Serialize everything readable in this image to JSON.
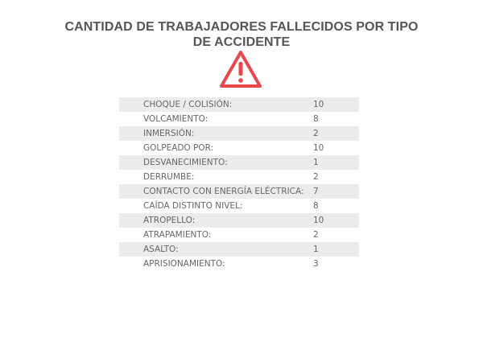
{
  "chart_data": {
    "type": "table",
    "title_lines": [
      "CANTIDAD DE TRABAJADORES FALLECIDOS POR TIPO",
      "DE ACCIDENTE"
    ],
    "icon": "warning-triangle-icon",
    "colors": {
      "icon": "#e8474b",
      "row_shade": "#ececec",
      "text": "#666666",
      "title": "#555555"
    },
    "rows": [
      {
        "label": "CHOQUE / COLISIÓN:",
        "value": "10"
      },
      {
        "label": "VOLCAMIENTO:",
        "value": "8"
      },
      {
        "label": "INMERSIÓN:",
        "value": "2"
      },
      {
        "label": "GOLPEADO POR:",
        "value": "10"
      },
      {
        "label": "DESVANECIMIENTO:",
        "value": "1"
      },
      {
        "label": "DERRUMBE:",
        "value": "2"
      },
      {
        "label": "CONTACTO CON ENERGÍA ELÉCTRICA:",
        "value": "7"
      },
      {
        "label": "CAÍDA DISTINTO NIVEL:",
        "value": "8"
      },
      {
        "label": "ATROPELLO:",
        "value": "10"
      },
      {
        "label": "ATRAPAMIENTO:",
        "value": "2"
      },
      {
        "label": "ASALTO:",
        "value": "1"
      },
      {
        "label": "APRISIONAMIENTO:",
        "value": "3"
      }
    ]
  }
}
